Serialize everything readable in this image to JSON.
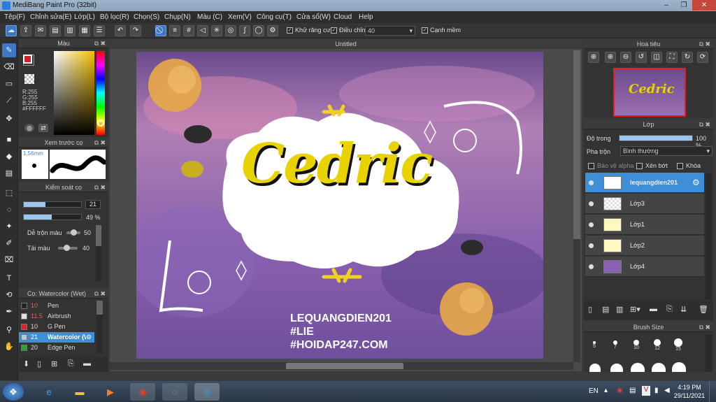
{
  "window": {
    "title": "MediBang Paint Pro (32bit)"
  },
  "menu": [
    "Tệp(F)",
    "Chỉnh sửa(E)",
    "Lớp(L)",
    "Bộ lọc(R)",
    "Chọn(S)",
    "Chụp(N)",
    "Màu (C)",
    "Xem(V)",
    "Công cụ(T)",
    "Cửa sổ(W)",
    "Cloud",
    "Help"
  ],
  "toolbar": {
    "antialias_label": "Khử răng cưa",
    "adjust_label": "Điều chỉnh",
    "adjust_value": "40",
    "edge_label": "Cạnh mềm"
  },
  "color_panel": {
    "title": "Màu",
    "r": "R:255",
    "g": "G:255",
    "b": "B:255",
    "hex": "#FFFFFF",
    "colors": {
      "foreground": "#d42020",
      "background": "#ffffff"
    }
  },
  "brush_preview": {
    "title": "Xem trước cọ",
    "size": "1.56mm"
  },
  "brush_control": {
    "title": "Kiểm soát cọ",
    "size_value": "21",
    "opacity_value": "49 %",
    "opacity": 0.49,
    "blend_label": "Dễ trộn màu",
    "blend_value": "50",
    "reload_label": "Tải màu",
    "reload_value": "40"
  },
  "brush_list": {
    "title": "Cọ: Watercolor (Wet)",
    "items": [
      {
        "size": "10",
        "name": "Pen",
        "color": "#222222"
      },
      {
        "size": "11.5",
        "name": "Airbrush",
        "color": "#e0e0e0"
      },
      {
        "size": "10",
        "name": "G Pen",
        "color": "#e02020"
      },
      {
        "size": "21",
        "name": "Watercolor (Wet)",
        "color": "#9fd0f0"
      },
      {
        "size": "20",
        "name": "Edge Pen",
        "color": "#22aa22"
      }
    ]
  },
  "canvas": {
    "tab": "Untitled",
    "art_title": "Cedric",
    "art_lines": [
      "LEQUANGDIEN201",
      "#LIE",
      "#HOIDAP247.COM"
    ]
  },
  "navigator": {
    "title": "Hoa tiêu",
    "thumb_title": "Cedric"
  },
  "layer_panel": {
    "title": "Lớp",
    "opacity_label": "Độ trong",
    "opacity_value": "100 %",
    "opacity": 1.0,
    "blend_label": "Pha trộn",
    "blend_value": "Bình thường",
    "protect_alpha": "Bảo vệ alpha",
    "clip_label": "Xén bớt",
    "lock_label": "Khóa",
    "layers": [
      "lequangdien201",
      "Lớp3",
      "Lớp1",
      "Lớp2",
      "Lớp4"
    ]
  },
  "brush_size": {
    "title": "Brush Size",
    "sizes": [
      "5",
      "7",
      "10",
      "12",
      "15"
    ]
  },
  "taskbar": {
    "lang": "EN",
    "time": "4:19 PM",
    "date": "29/11/2021"
  }
}
